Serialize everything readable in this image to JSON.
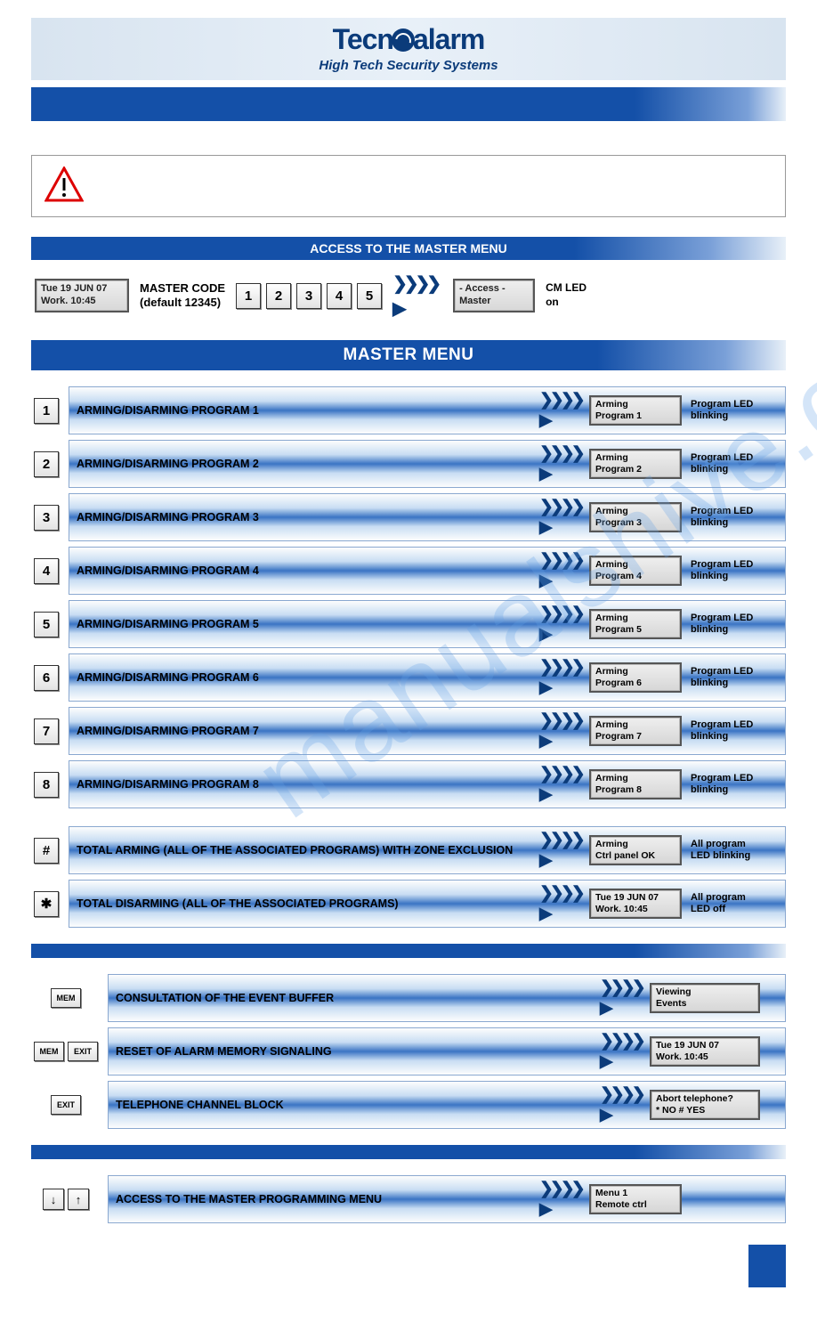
{
  "brand": {
    "name_part1": "Tecn",
    "name_part2": "alarm",
    "tagline": "High Tech Security Systems"
  },
  "access": {
    "title": "ACCESS TO THE MASTER MENU",
    "lcd_line1": "Tue   19 JUN 07",
    "lcd_line2": "Work.    10:45",
    "code_label_l1": "MASTER CODE",
    "code_label_l2": "(default 12345)",
    "keys": [
      "1",
      "2",
      "3",
      "4",
      "5"
    ],
    "result_lcd_l1": "- Access -",
    "result_lcd_l2": "Master",
    "note_l1": "CM LED",
    "note_l2": "on"
  },
  "master_menu_title": "MASTER MENU",
  "programs": [
    {
      "key": "1",
      "label": "ARMING/DISARMING PROGRAM 1",
      "lcd_l1": "Arming",
      "lcd_l2": "Program 1",
      "note_l1": "Program LED",
      "note_l2": "blinking"
    },
    {
      "key": "2",
      "label": "ARMING/DISARMING PROGRAM 2",
      "lcd_l1": "Arming",
      "lcd_l2": "Program 2",
      "note_l1": "Program LED",
      "note_l2": "blinking"
    },
    {
      "key": "3",
      "label": "ARMING/DISARMING PROGRAM 3",
      "lcd_l1": "Arming",
      "lcd_l2": "Program 3",
      "note_l1": "Program LED",
      "note_l2": "blinking"
    },
    {
      "key": "4",
      "label": "ARMING/DISARMING PROGRAM 4",
      "lcd_l1": "Arming",
      "lcd_l2": "Program 4",
      "note_l1": "Program LED",
      "note_l2": "blinking"
    },
    {
      "key": "5",
      "label": "ARMING/DISARMING PROGRAM 5",
      "lcd_l1": "Arming",
      "lcd_l2": "Program 5",
      "note_l1": "Program LED",
      "note_l2": "blinking"
    },
    {
      "key": "6",
      "label": "ARMING/DISARMING PROGRAM 6",
      "lcd_l1": "Arming",
      "lcd_l2": "Program 6",
      "note_l1": "Program LED",
      "note_l2": "blinking"
    },
    {
      "key": "7",
      "label": "ARMING/DISARMING PROGRAM 7",
      "lcd_l1": "Arming",
      "lcd_l2": "Program 7",
      "note_l1": "Program LED",
      "note_l2": "blinking"
    },
    {
      "key": "8",
      "label": "ARMING/DISARMING PROGRAM 8",
      "lcd_l1": "Arming",
      "lcd_l2": "Program 8",
      "note_l1": "Program LED",
      "note_l2": "blinking"
    }
  ],
  "totals": [
    {
      "key": "#",
      "label": "TOTAL ARMING (ALL OF THE ASSOCIATED PROGRAMS) WITH ZONE EXCLUSION",
      "lcd_l1": "Arming",
      "lcd_l2": "Ctrl panel OK",
      "note_l1": "All program",
      "note_l2": "LED blinking"
    },
    {
      "key": "✱",
      "label": "TOTAL DISARMING (ALL OF THE ASSOCIATED PROGRAMS)",
      "lcd_l1": "Tue   19 JUN 07",
      "lcd_l2": "Work.    10:45",
      "note_l1": "All program",
      "note_l2": "LED off"
    }
  ],
  "extras": [
    {
      "keys": [
        "MEM"
      ],
      "label": "CONSULTATION OF THE EVENT BUFFER",
      "lcd_l1": "Viewing",
      "lcd_l2": "Events"
    },
    {
      "keys": [
        "MEM",
        "EXIT"
      ],
      "label": "RESET OF ALARM MEMORY SIGNALING",
      "lcd_l1": "Tue   19 JUN 07",
      "lcd_l2": "Work.    10:45"
    },
    {
      "keys": [
        "EXIT"
      ],
      "label": "TELEPHONE CHANNEL BLOCK",
      "lcd_l1": "Abort telephone?",
      "lcd_l2": " * NO    # YES"
    }
  ],
  "nav": {
    "keys": [
      "↓",
      "↑"
    ],
    "label": "ACCESS TO THE MASTER PROGRAMMING MENU",
    "lcd_l1": "Menu               1",
    "lcd_l2": "Remote ctrl"
  },
  "watermark": "manualshive.com"
}
